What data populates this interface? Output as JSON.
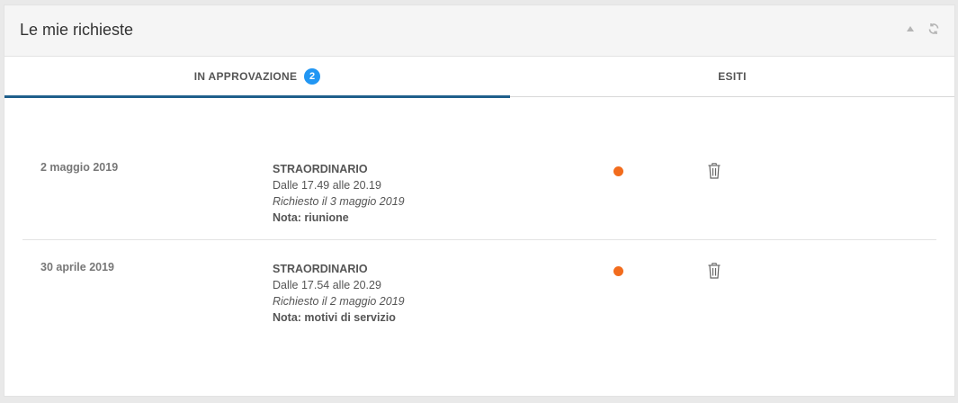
{
  "widget": {
    "title": "Le mie richieste"
  },
  "tabs": [
    {
      "label": "IN APPROVAZIONE",
      "count": "2",
      "active": true
    },
    {
      "label": "ESITI",
      "active": false
    }
  ],
  "colors": {
    "accent": "#1f5f8b",
    "badge": "#2196f3",
    "status_pending": "#f26c1d"
  },
  "requests": [
    {
      "date": "2 maggio 2019",
      "type": "STRAORDINARIO",
      "time_range": "Dalle 17.49 alle 20.19",
      "requested": "Richiesto il 3 maggio 2019",
      "note": "Nota: riunione",
      "status_icon": "status-dot",
      "action_icon": "trash-icon"
    },
    {
      "date": "30 aprile 2019",
      "type": "STRAORDINARIO",
      "time_range": "Dalle 17.54 alle 20.29",
      "requested": "Richiesto il 2 maggio 2019",
      "note": "Nota: motivi di servizio",
      "status_icon": "status-dot",
      "action_icon": "trash-icon"
    }
  ]
}
